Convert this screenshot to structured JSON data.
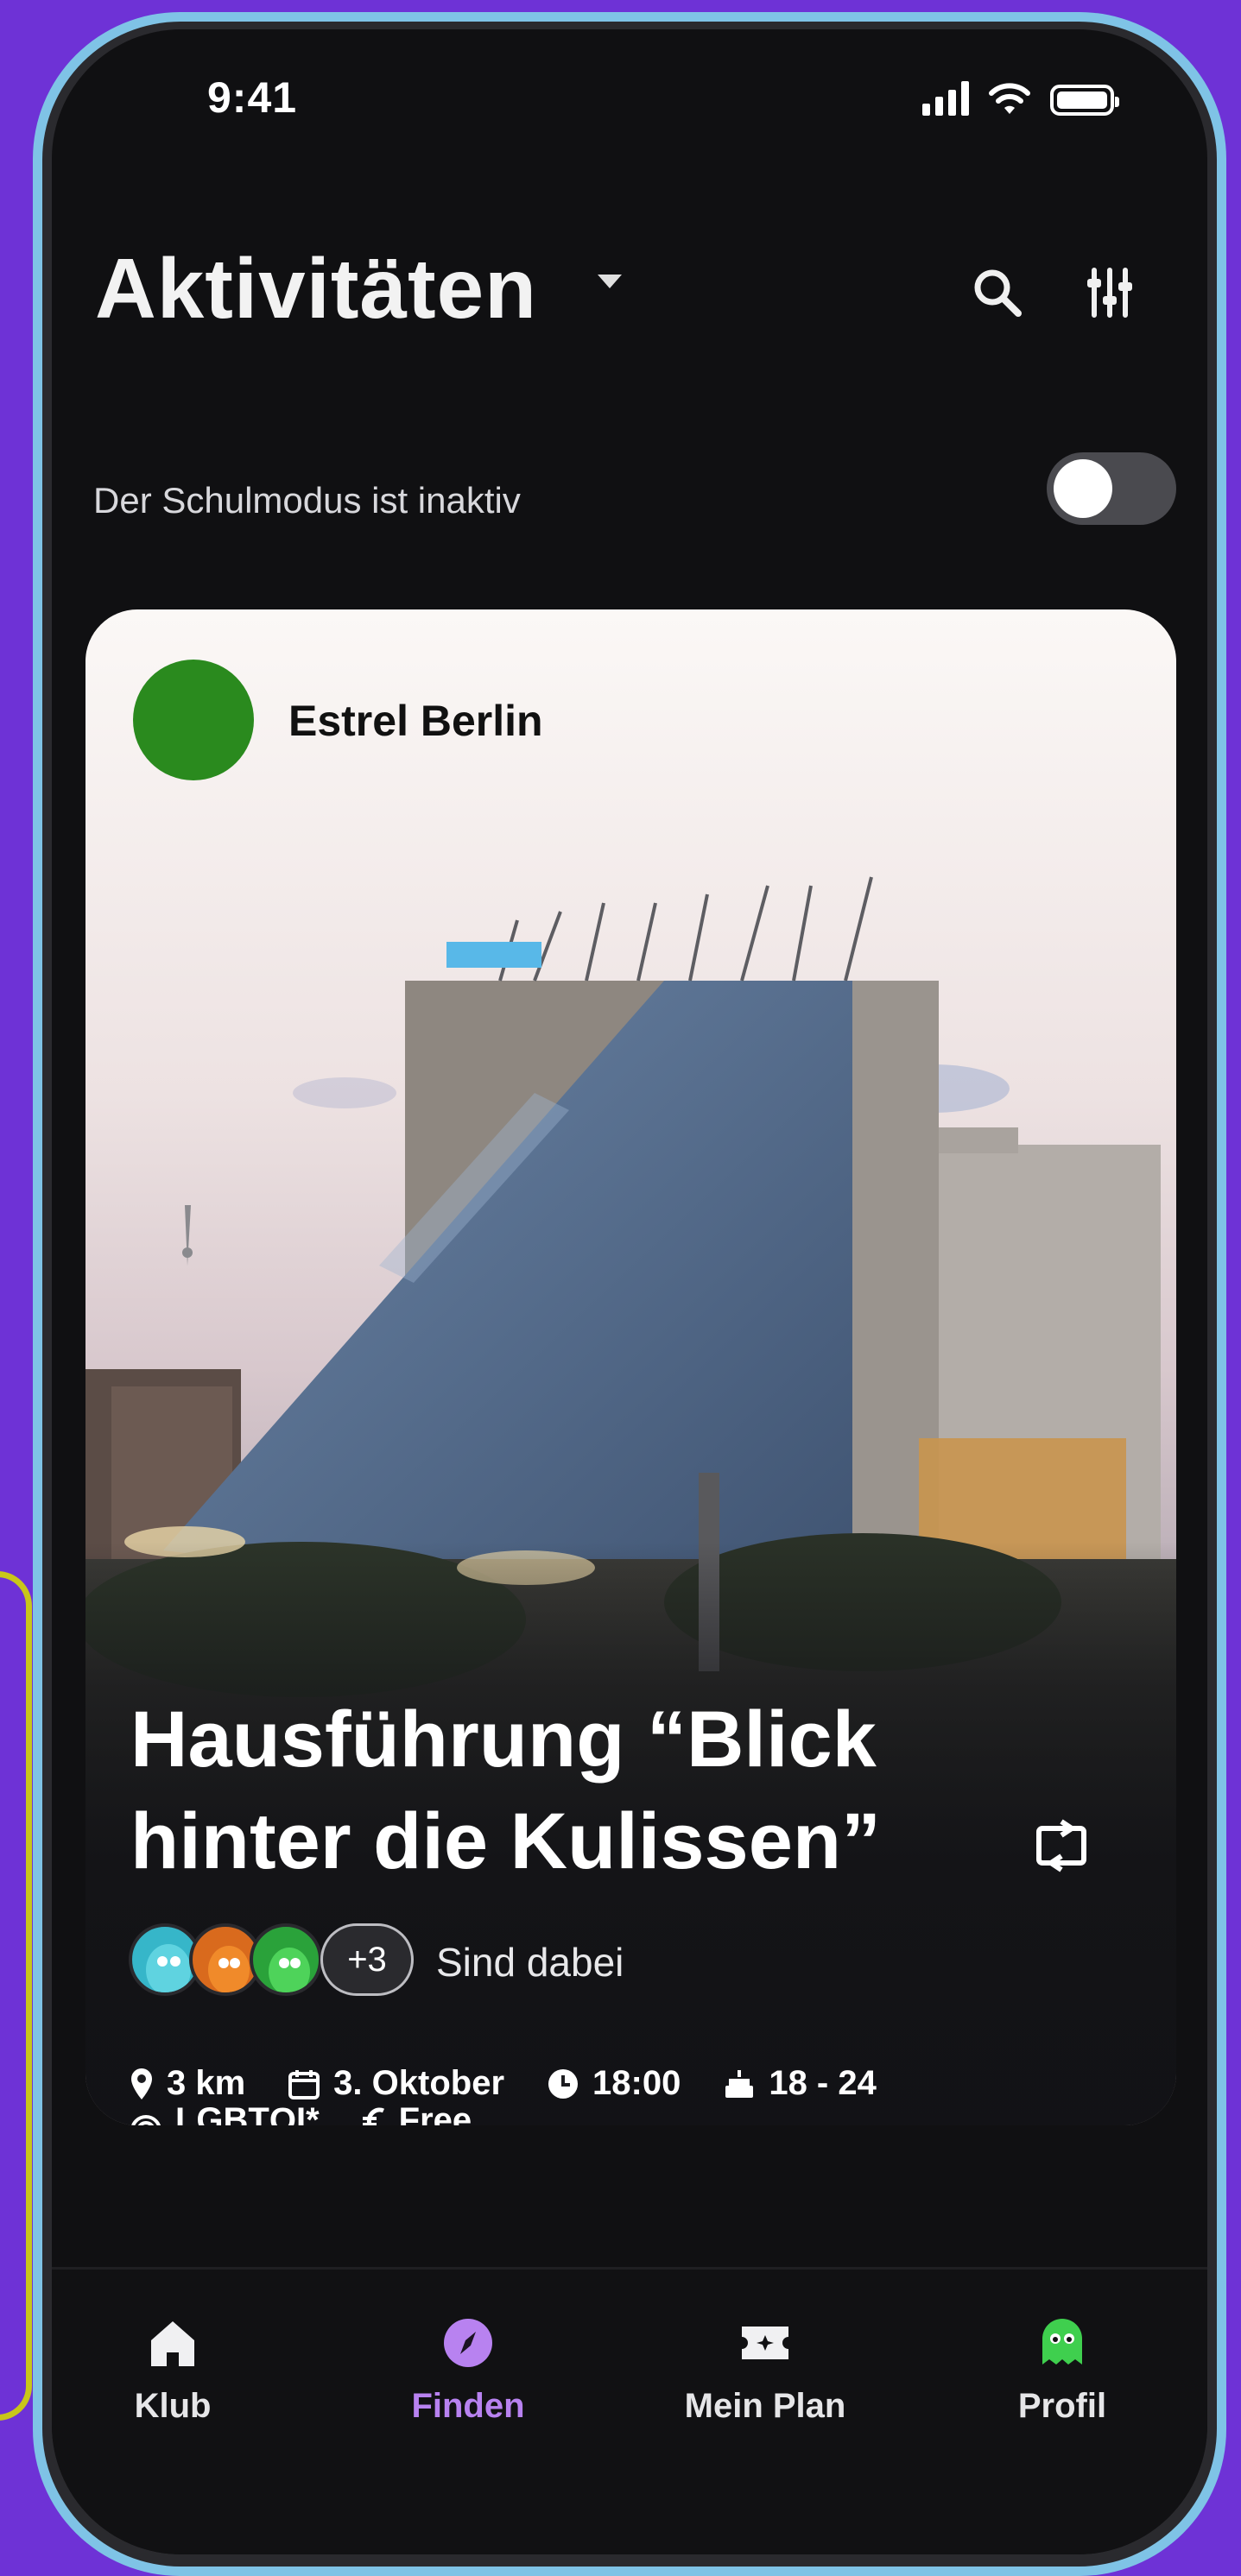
{
  "status_bar": {
    "time": "9:41"
  },
  "header": {
    "title": "Aktivitäten"
  },
  "school_mode": {
    "label": "Der Schulmodus ist inaktiv",
    "enabled": false
  },
  "event_card": {
    "organizer": "Estrel Berlin",
    "title": "Hausführung “Blick hinter die Kulissen”",
    "participants": {
      "more_count": "+3",
      "label": "Sind dabei"
    },
    "meta": {
      "distance": "3 km",
      "date": "3. Oktober",
      "time": "18:00",
      "age": "18 - 24",
      "tag": "LGBTQI*",
      "price": "Free"
    }
  },
  "tabbar": {
    "items": [
      {
        "label": "Klub",
        "icon": "home-icon"
      },
      {
        "label": "Finden",
        "icon": "compass-icon",
        "active": true
      },
      {
        "label": "Mein Plan",
        "icon": "ticket-icon"
      },
      {
        "label": "Profil",
        "icon": "monster-avatar-icon"
      }
    ]
  },
  "colors": {
    "background": "#6e32d6",
    "accent": "#b882f0",
    "organizer_avatar": "#2a8a1e"
  }
}
